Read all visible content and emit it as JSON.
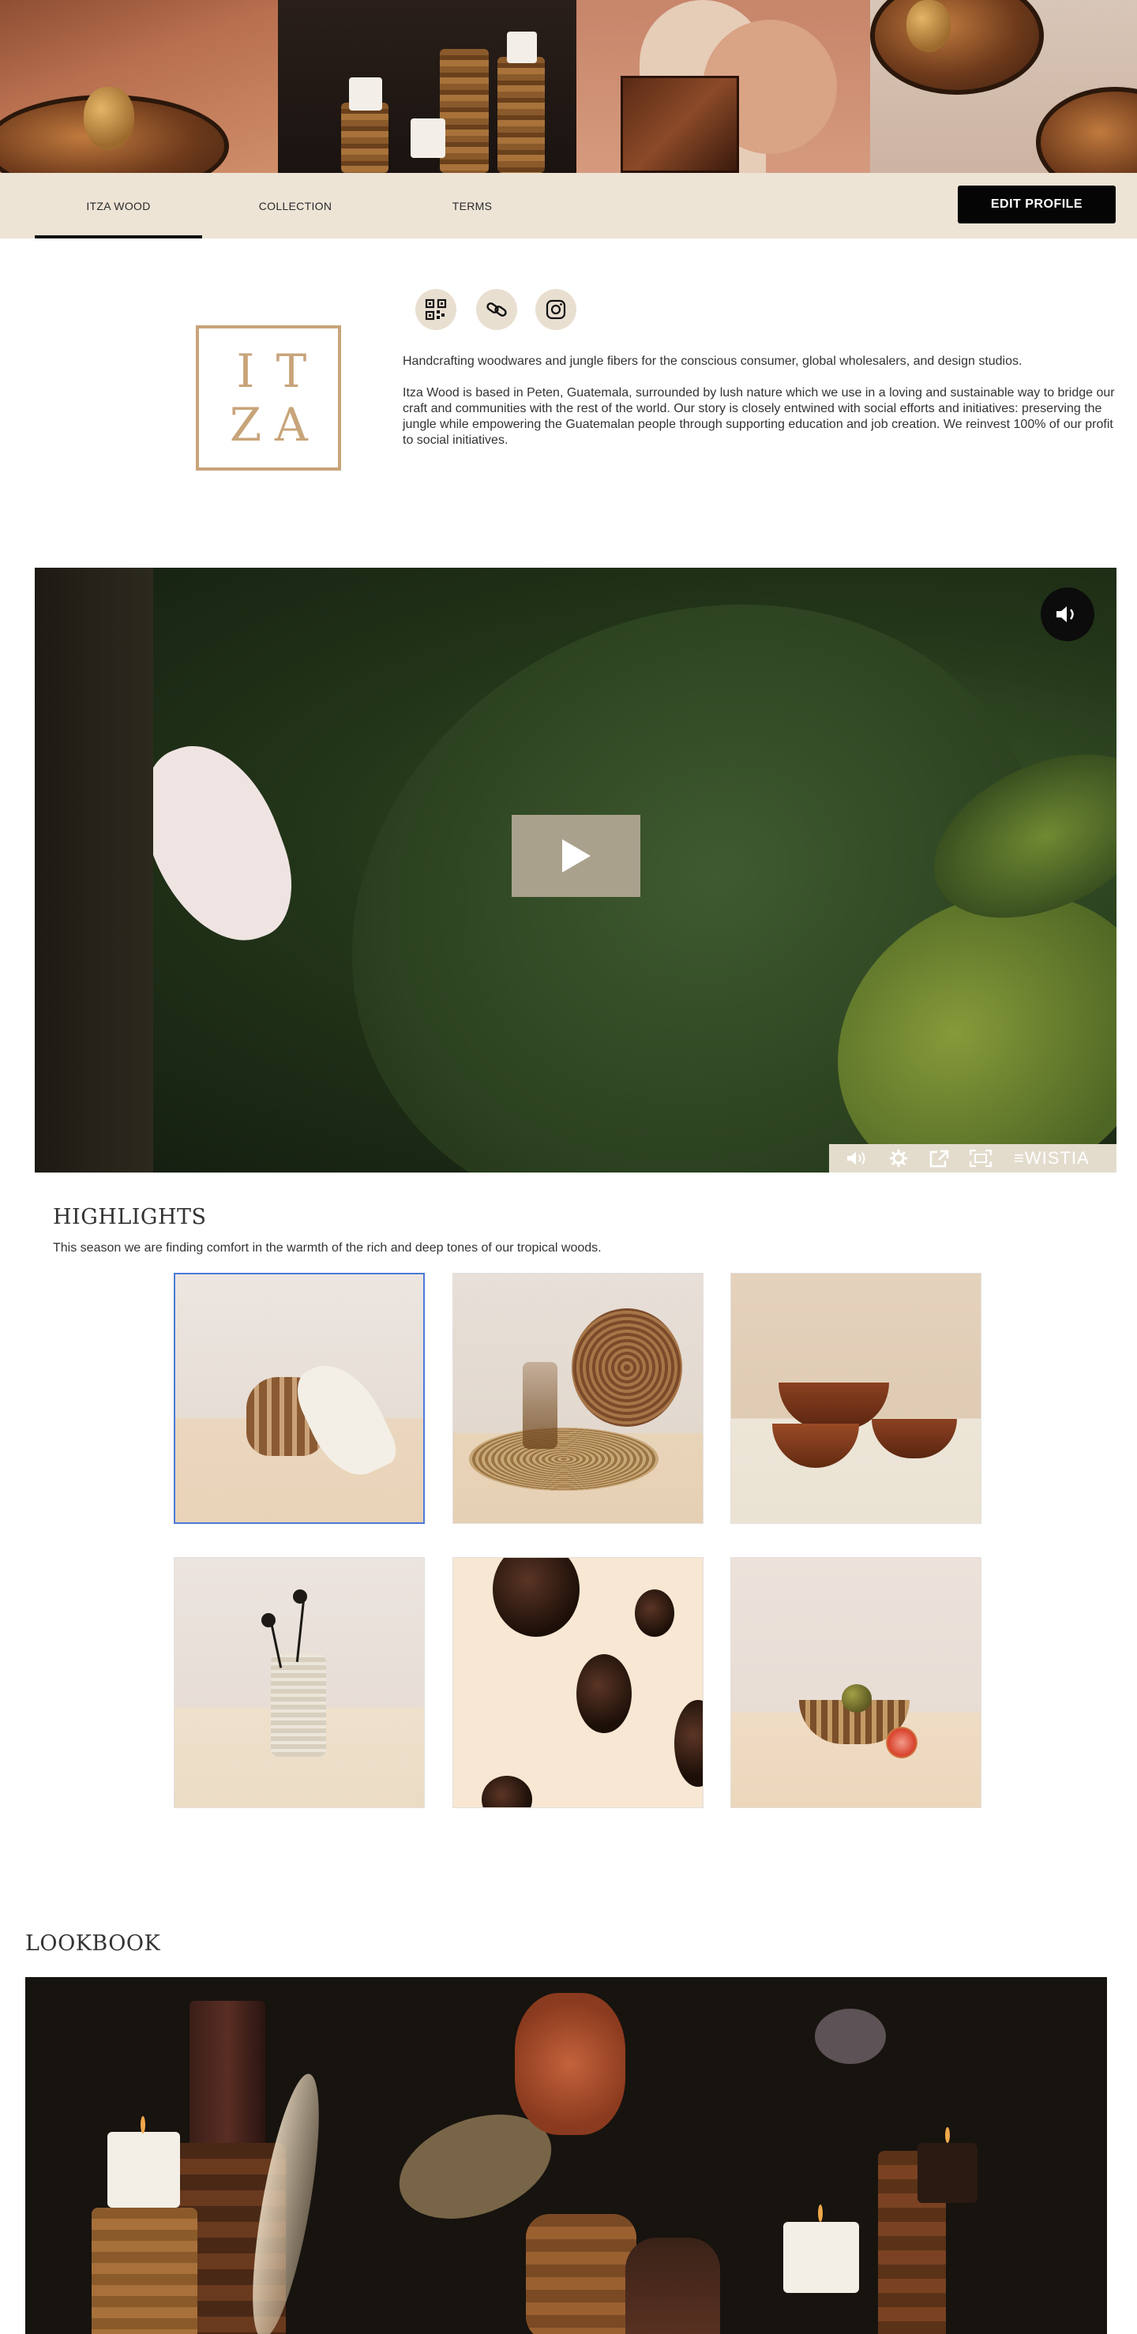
{
  "nav": {
    "tabs": [
      {
        "label": "ITZA WOOD"
      },
      {
        "label": "COLLECTION"
      },
      {
        "label": "TERMS"
      }
    ],
    "edit_label": "EDIT PROFILE"
  },
  "profile": {
    "logo_letters": [
      "I",
      "T",
      "Z",
      "A"
    ],
    "social_icons": [
      "qr-code-icon",
      "link-icon",
      "instagram-icon"
    ],
    "tagline": "Handcrafting woodwares and jungle fibers for the conscious consumer, global wholesalers, and design studios.",
    "description": "Itza Wood is based in Peten, Guatemala, surrounded by lush nature which we use in a loving and sustainable way to bridge our craft and communities with the rest of the world. Our story is closely entwined with social efforts and initiatives: preserving the jungle while empowering the Guatemalan people through supporting education and job creation. We reinvest 100% of our profit to social initiatives."
  },
  "video": {
    "brand": "WISTIA",
    "controls": [
      "volume-icon",
      "settings-icon",
      "share-icon",
      "fullscreen-icon"
    ]
  },
  "highlights": {
    "title": "HIGHLIGHTS",
    "subtitle": "This season we are finding comfort in the warmth of the rich and deep tones of our tropical woods."
  },
  "lookbook": {
    "title": "LOOKBOOK"
  },
  "colors": {
    "nav_bg": "#ede4d6",
    "accent_gold": "#c8a47a",
    "button_bg": "#050505",
    "selection_border": "#4a7ad8"
  }
}
